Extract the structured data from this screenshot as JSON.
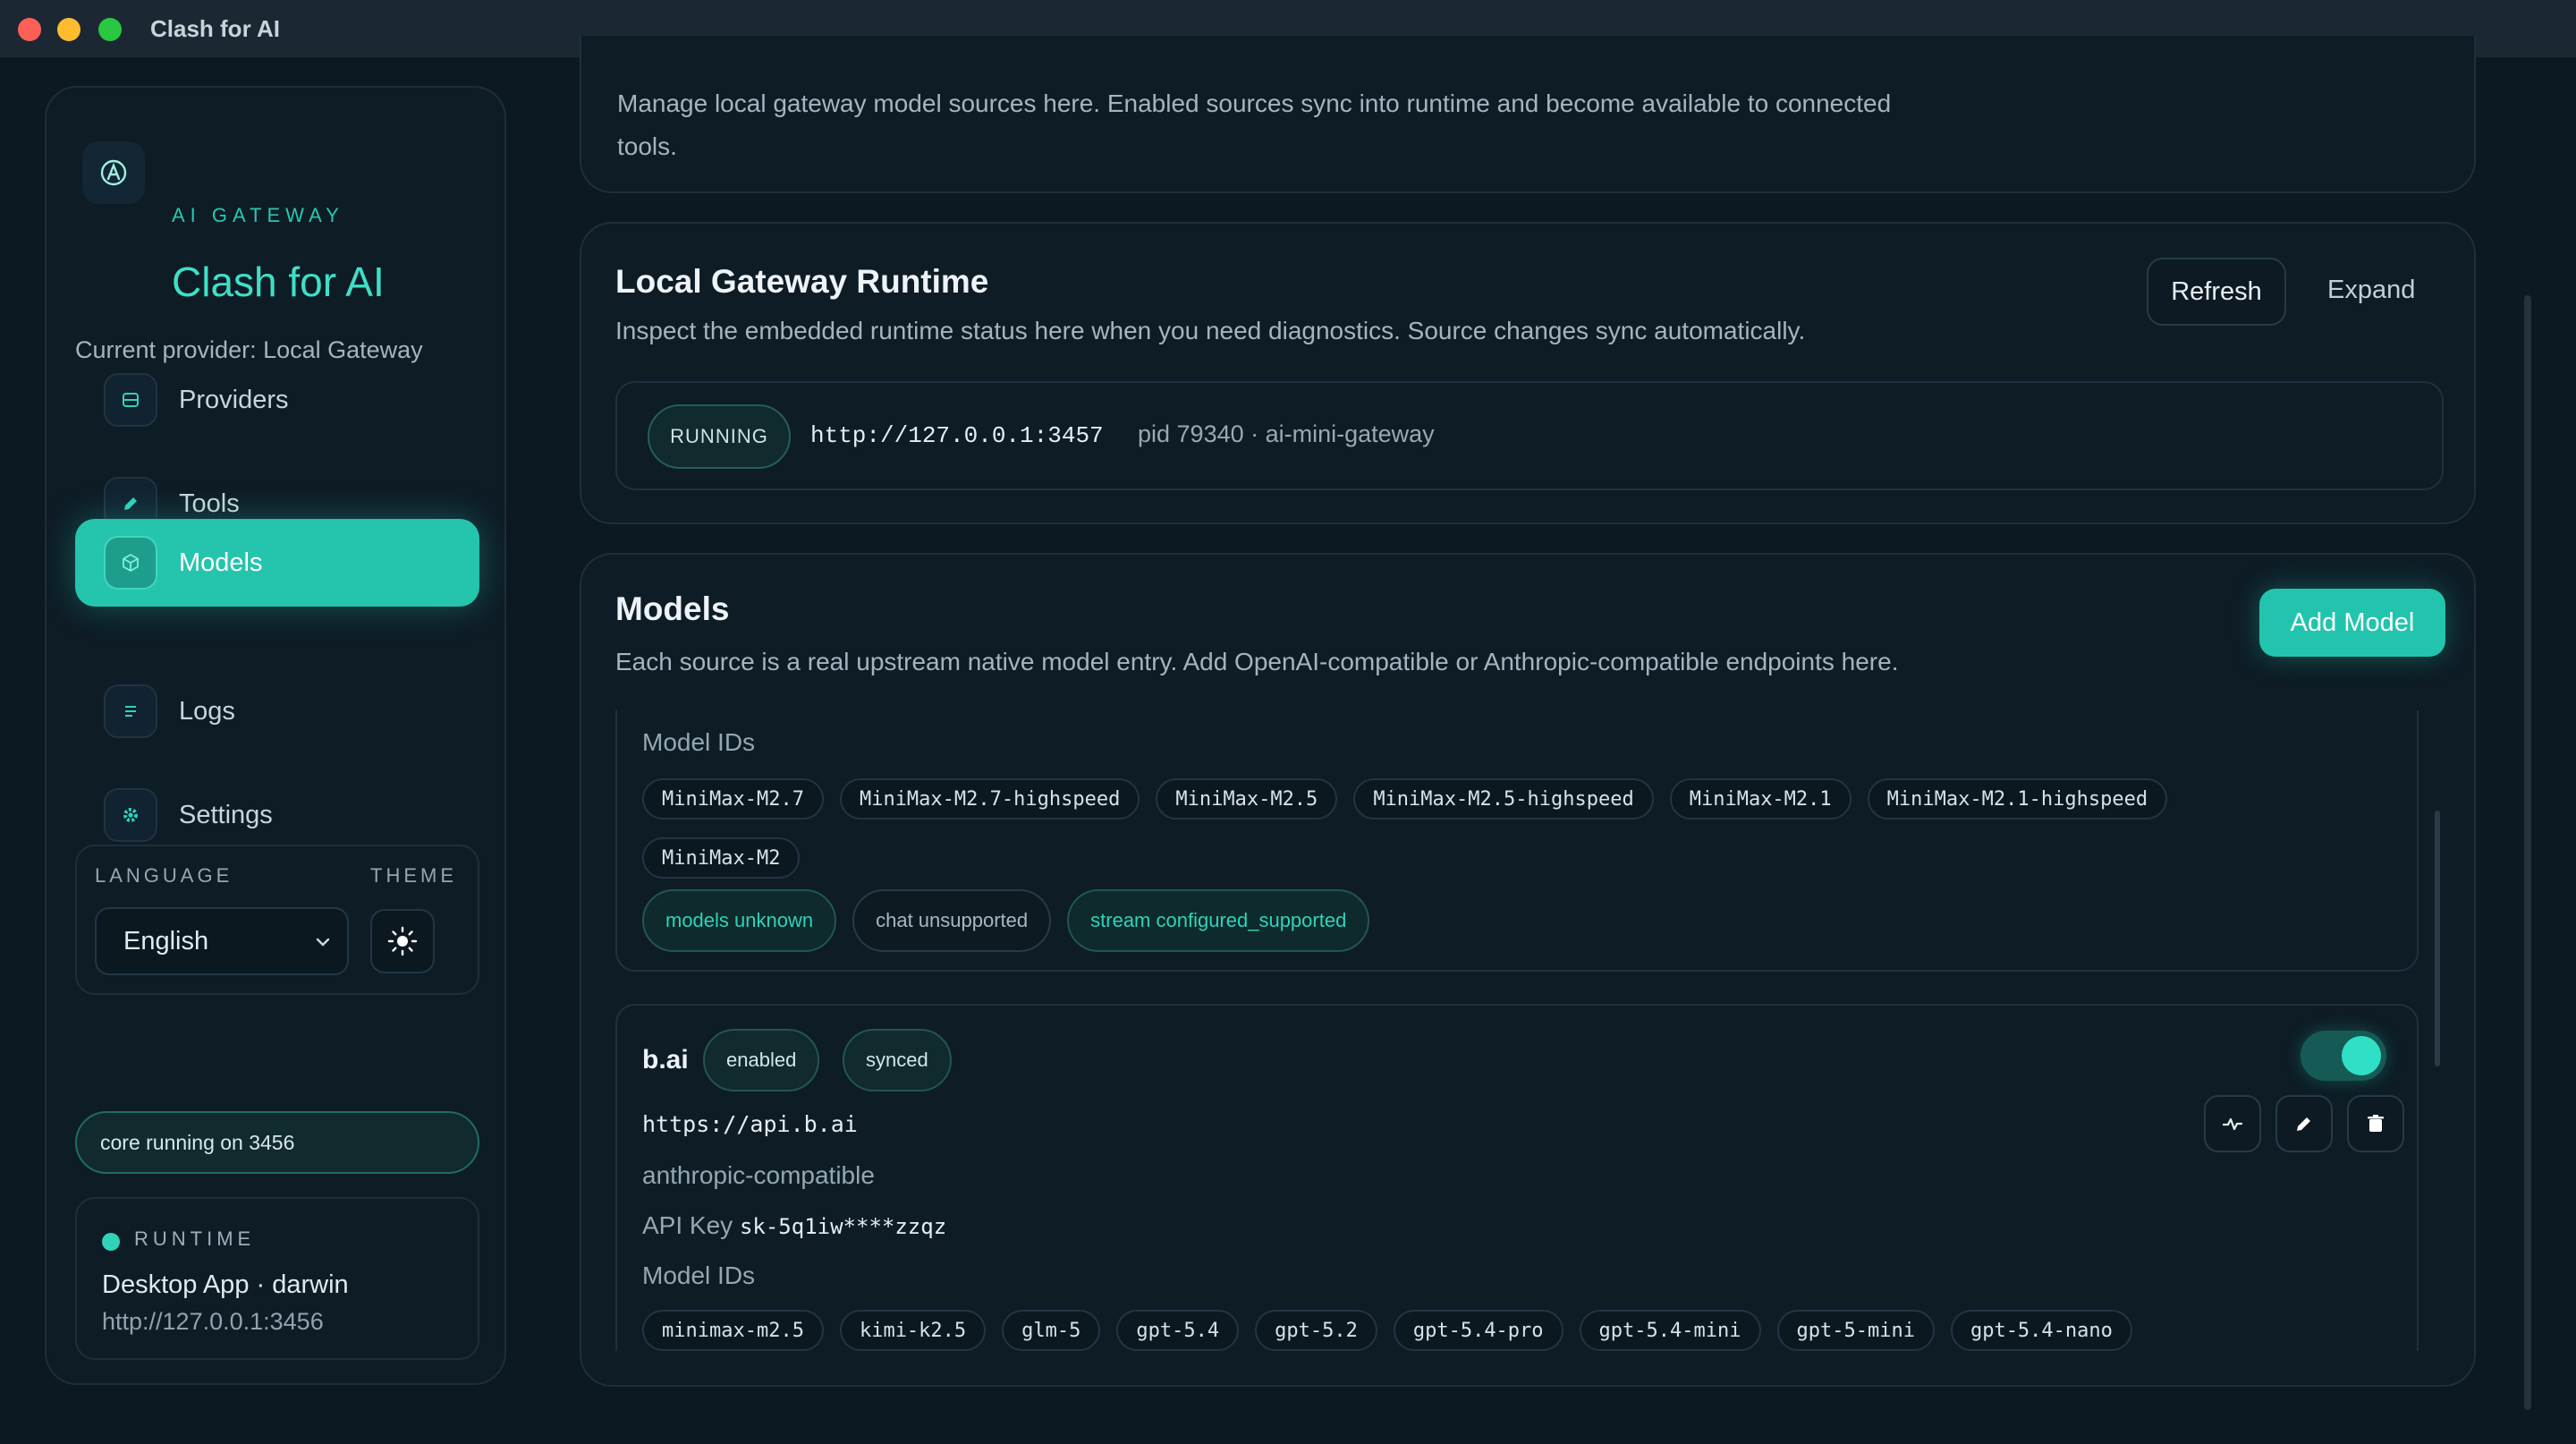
{
  "window": {
    "title": "Clash for AI"
  },
  "sidebar": {
    "eyebrow": "AI GATEWAY",
    "title": "Clash for AI",
    "current_provider": "Current provider: Local Gateway",
    "nav": [
      {
        "label": "Providers",
        "icon": "server-icon"
      },
      {
        "label": "Tools",
        "icon": "pencil-icon"
      },
      {
        "label": "Models",
        "icon": "cube-icon",
        "active": true
      },
      {
        "label": "Logs",
        "icon": "list-icon"
      },
      {
        "label": "Settings",
        "icon": "gear-icon"
      }
    ],
    "language_label": "LANGUAGE",
    "theme_label": "THEME",
    "language_value": "English",
    "core_status": "core running on 3456",
    "runtime": {
      "label": "RUNTIME",
      "app": "Desktop App · darwin",
      "url": "http://127.0.0.1:3456"
    }
  },
  "intro": {
    "text": "Manage local gateway model sources here. Enabled sources sync into runtime and become available to connected tools."
  },
  "runtime_card": {
    "title": "Local Gateway Runtime",
    "description": "Inspect the embedded runtime status here when you need diagnostics. Source changes sync automatically.",
    "refresh_label": "Refresh",
    "expand_label": "Expand",
    "status": "RUNNING",
    "endpoint": "http://127.0.0.1:3457",
    "pid_info": "pid 79340 · ai-mini-gateway"
  },
  "models_card": {
    "title": "Models",
    "description": "Each source is a real upstream native model entry. Add OpenAI-compatible or Anthropic-compatible endpoints here.",
    "add_label": "Add Model",
    "sources": [
      {
        "model_ids_label": "Model IDs",
        "model_ids": [
          "MiniMax-M2.7",
          "MiniMax-M2.7-highspeed",
          "MiniMax-M2.5",
          "MiniMax-M2.5-highspeed",
          "MiniMax-M2.1",
          "MiniMax-M2.1-highspeed",
          "MiniMax-M2"
        ],
        "capabilities": [
          "models unknown",
          "chat unsupported",
          "stream configured_supported"
        ]
      },
      {
        "name": "b.ai",
        "badges": [
          "enabled",
          "synced"
        ],
        "enabled": true,
        "url": "https://api.b.ai",
        "type": "anthropic-compatible",
        "api_key_label": "API Key",
        "api_key": "sk-5q1iw****zzqz",
        "model_ids_label": "Model IDs",
        "model_ids": [
          "minimax-m2.5",
          "kimi-k2.5",
          "glm-5",
          "gpt-5.4",
          "gpt-5.2",
          "gpt-5.4-pro",
          "gpt-5.4-mini",
          "gpt-5-mini",
          "gpt-5.4-nano"
        ]
      }
    ]
  },
  "colors": {
    "accent": "#22c4ad",
    "background": "#0c1822",
    "card": "#0e1c26"
  }
}
